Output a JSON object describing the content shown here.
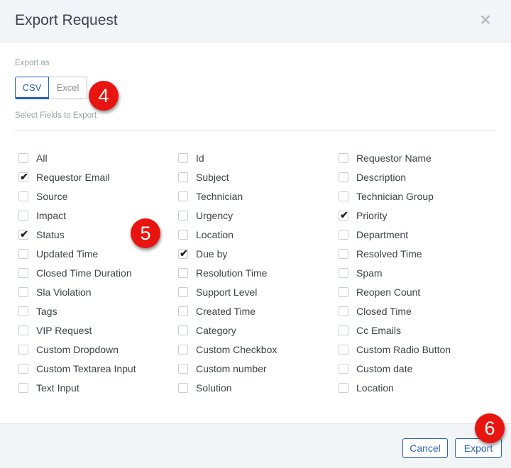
{
  "dialog": {
    "title": "Export Request",
    "close_icon": "close-icon"
  },
  "export_as": {
    "label": "Export as",
    "options": [
      "CSV",
      "Excel"
    ],
    "selected": "CSV"
  },
  "fields_section": {
    "label": "Select Fields to Export"
  },
  "fields": [
    [
      {
        "label": "All",
        "checked": false
      },
      {
        "label": "Requestor Email",
        "checked": true
      },
      {
        "label": "Source",
        "checked": false
      },
      {
        "label": "Impact",
        "checked": false
      },
      {
        "label": "Status",
        "checked": true
      },
      {
        "label": "Updated Time",
        "checked": false
      },
      {
        "label": "Closed Time Duration",
        "checked": false
      },
      {
        "label": "Sla Violation",
        "checked": false
      },
      {
        "label": "Tags",
        "checked": false
      },
      {
        "label": "VIP Request",
        "checked": false
      },
      {
        "label": "Custom Dropdown",
        "checked": false
      },
      {
        "label": "Custom Textarea Input",
        "checked": false
      },
      {
        "label": "Text Input",
        "checked": false
      }
    ],
    [
      {
        "label": "Id",
        "checked": false
      },
      {
        "label": "Subject",
        "checked": false
      },
      {
        "label": "Technician",
        "checked": false
      },
      {
        "label": "Urgency",
        "checked": false
      },
      {
        "label": "Location",
        "checked": false
      },
      {
        "label": "Due by",
        "checked": true
      },
      {
        "label": "Resolution Time",
        "checked": false
      },
      {
        "label": "Support Level",
        "checked": false
      },
      {
        "label": "Created Time",
        "checked": false
      },
      {
        "label": "Category",
        "checked": false
      },
      {
        "label": "Custom Checkbox",
        "checked": false
      },
      {
        "label": "Custom number",
        "checked": false
      },
      {
        "label": "Solution",
        "checked": false
      }
    ],
    [
      {
        "label": "Requestor Name",
        "checked": false
      },
      {
        "label": "Description",
        "checked": false
      },
      {
        "label": "Technician Group",
        "checked": false
      },
      {
        "label": "Priority",
        "checked": true
      },
      {
        "label": "Department",
        "checked": false
      },
      {
        "label": "Resolved Time",
        "checked": false
      },
      {
        "label": "Spam",
        "checked": false
      },
      {
        "label": "Reopen Count",
        "checked": false
      },
      {
        "label": "Closed Time",
        "checked": false
      },
      {
        "label": "Cc Emails",
        "checked": false
      },
      {
        "label": "Custom Radio Button",
        "checked": false
      },
      {
        "label": "Custom date",
        "checked": false
      },
      {
        "label": "Location",
        "checked": false
      }
    ]
  ],
  "footer": {
    "cancel_label": "Cancel",
    "export_label": "Export"
  },
  "annotations": [
    "4",
    "5",
    "6"
  ],
  "colors": {
    "accent": "#2460b8",
    "badge": "#e8140f",
    "header_bg": "#f2f5f8"
  }
}
